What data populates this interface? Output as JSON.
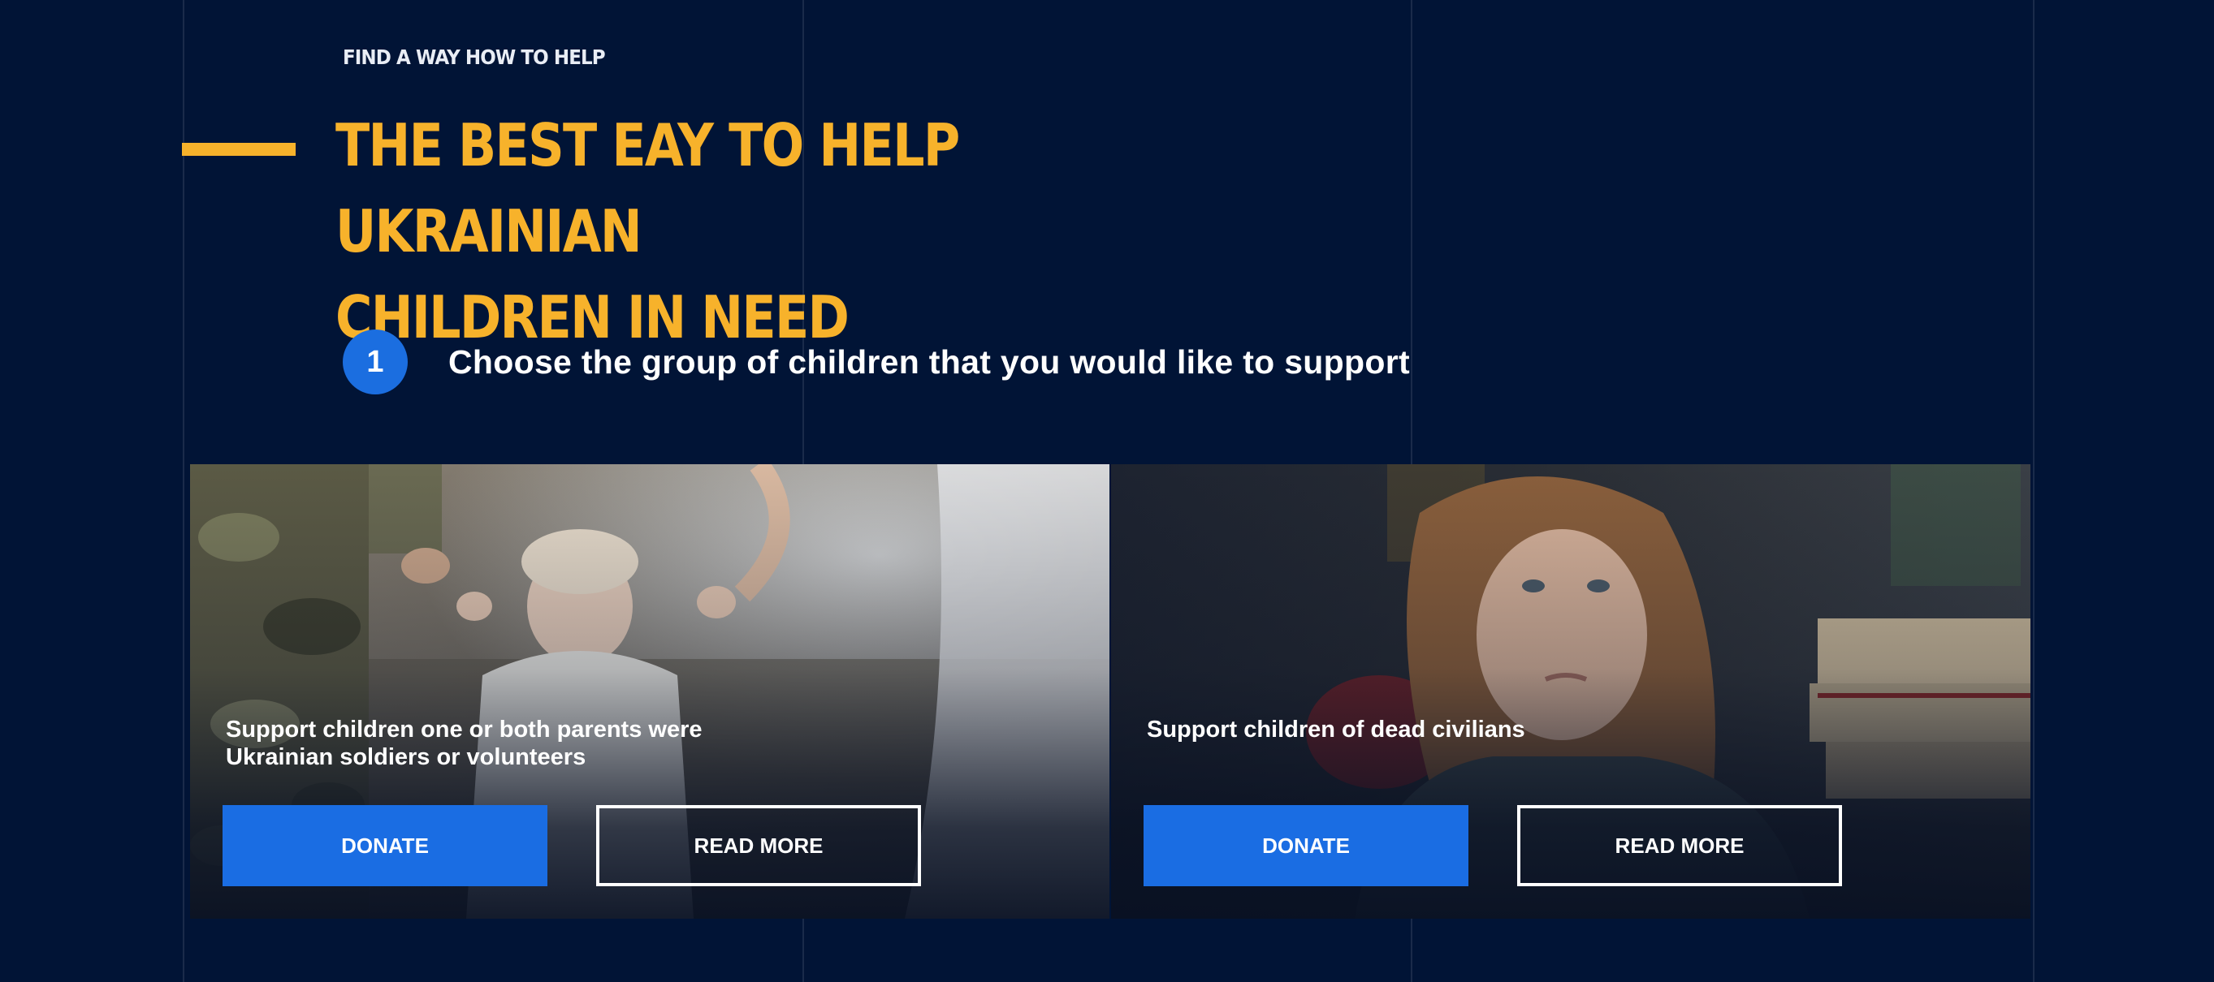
{
  "section": {
    "eyebrow": "FIND A WAY HOW TO HELP",
    "headline_line1": "THE BEST EAY TO HELP UKRAINIAN",
    "headline_line2": "CHILDREN IN NEED"
  },
  "step": {
    "number": "1",
    "text": "Choose the group of children that you would like to support"
  },
  "cards": [
    {
      "title_line1": "Support children one or both parents were",
      "title_line2": "Ukrainian soldiers or volunteers",
      "donate_label": "DONATE",
      "read_more_label": "READ MORE"
    },
    {
      "title_line1": "Support children of dead civilians",
      "title_line2": "",
      "donate_label": "DONATE",
      "read_more_label": "READ MORE"
    }
  ],
  "colors": {
    "background": "#011436",
    "accent_yellow": "#f7b22b",
    "brand_blue": "#1a6de3"
  }
}
